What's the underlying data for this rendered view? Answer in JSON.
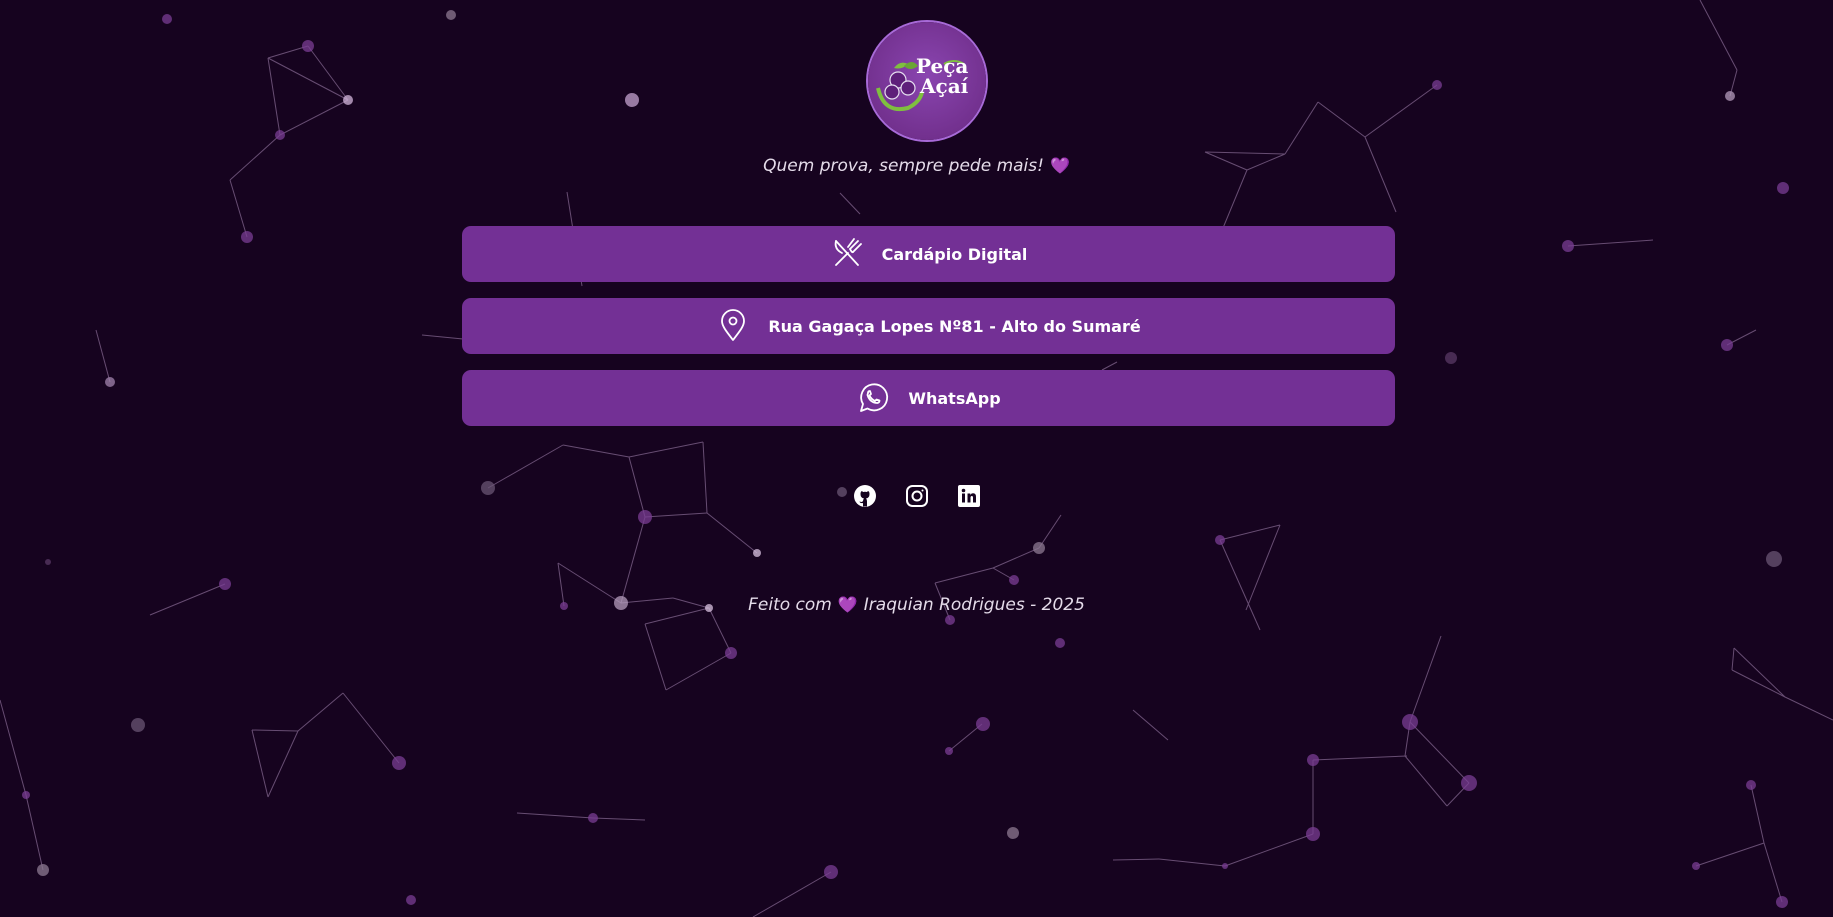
{
  "brand": {
    "logo_line1": "Peça",
    "logo_line2": "Açaí"
  },
  "tagline": {
    "text": "Quem prova, sempre pede mais!",
    "heart": "💜"
  },
  "links": [
    {
      "label": "Cardápio Digital",
      "icon": "utensils-icon"
    },
    {
      "label": "Rua Gagaça Lopes Nº81 - Alto do Sumaré",
      "icon": "map-pin-icon"
    },
    {
      "label": "WhatsApp",
      "icon": "whatsapp-icon"
    }
  ],
  "socials": [
    {
      "name": "GitHub",
      "icon": "github-icon"
    },
    {
      "name": "Instagram",
      "icon": "instagram-icon"
    },
    {
      "name": "LinkedIn",
      "icon": "linkedin-icon"
    }
  ],
  "footer": {
    "prefix": "Feito com",
    "heart": "💜",
    "suffix": "Iraquian Rodrigues - 2025"
  },
  "colors": {
    "background": "#16031f",
    "button": "#733095",
    "accent": "#9a7bf0",
    "particle": "#7a3d94"
  }
}
